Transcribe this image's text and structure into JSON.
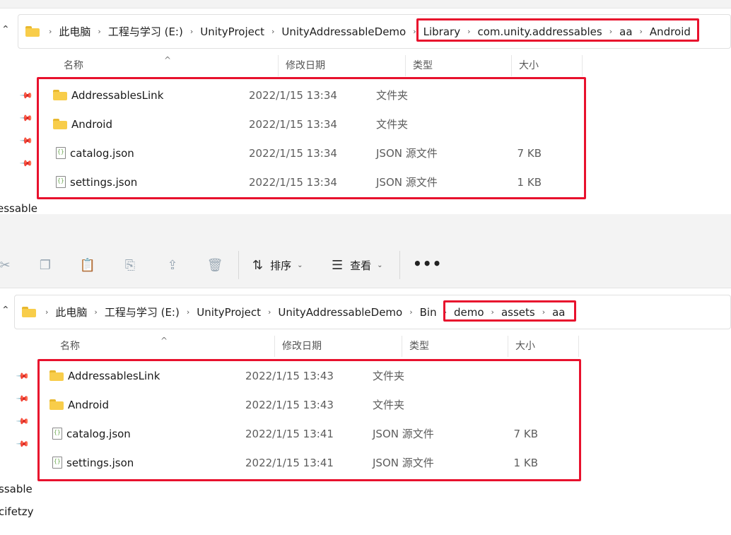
{
  "top": {
    "breadcrumb": [
      "此电脑",
      "工程与学习 (E:)",
      "UnityProject",
      "UnityAddressableDemo",
      "Library",
      "com.unity.addressables",
      "aa",
      "Android"
    ],
    "columns": {
      "name": "名称",
      "date": "修改日期",
      "type": "类型",
      "size": "大小"
    },
    "rows": [
      {
        "icon": "folder-icon",
        "name": "AddressablesLink",
        "date": "2022/1/15 13:34",
        "type": "文件夹",
        "size": ""
      },
      {
        "icon": "folder-icon",
        "name": "Android",
        "date": "2022/1/15 13:34",
        "type": "文件夹",
        "size": ""
      },
      {
        "icon": "json-file-icon",
        "name": "catalog.json",
        "date": "2022/1/15 13:34",
        "type": "JSON 源文件",
        "size": "7 KB"
      },
      {
        "icon": "json-file-icon",
        "name": "settings.json",
        "date": "2022/1/15 13:34",
        "type": "JSON 源文件",
        "size": "1 KB"
      }
    ],
    "left_text": "essable"
  },
  "toolbar": {
    "icons": [
      "cut-icon",
      "copy-icon",
      "paste-icon",
      "rename-icon",
      "share-icon",
      "delete-icon"
    ],
    "sort_label": "排序",
    "view_label": "查看",
    "more_label": "•••"
  },
  "bottom": {
    "breadcrumb": [
      "此电脑",
      "工程与学习 (E:)",
      "UnityProject",
      "UnityAddressableDemo",
      "Bin",
      "demo",
      "assets",
      "aa"
    ],
    "columns": {
      "name": "名称",
      "date": "修改日期",
      "type": "类型",
      "size": "大小"
    },
    "rows": [
      {
        "icon": "folder-icon",
        "name": "AddressablesLink",
        "date": "2022/1/15 13:43",
        "type": "文件夹",
        "size": ""
      },
      {
        "icon": "folder-icon",
        "name": "Android",
        "date": "2022/1/15 13:43",
        "type": "文件夹",
        "size": ""
      },
      {
        "icon": "json-file-icon",
        "name": "catalog.json",
        "date": "2022/1/15 13:41",
        "type": "JSON 源文件",
        "size": "7 KB"
      },
      {
        "icon": "json-file-icon",
        "name": "settings.json",
        "date": "2022/1/15 13:41",
        "type": "JSON 源文件",
        "size": "1 KB"
      }
    ],
    "left_text_1": "ssable",
    "left_text_2": "cifetzy"
  },
  "colors": {
    "highlight": "#e8112d",
    "folder": "#f8cd4a"
  }
}
